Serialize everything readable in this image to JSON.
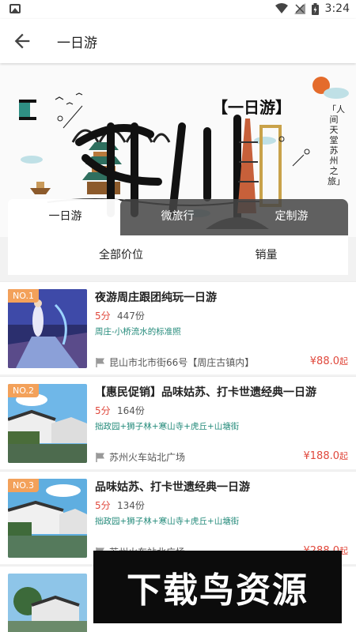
{
  "status_bar": {
    "time": "3:24",
    "icons": [
      "image-icon",
      "wifi-icon",
      "signal-icon",
      "battery-icon"
    ]
  },
  "app_bar": {
    "title": "一日游",
    "back_icon": "arrow-left-icon"
  },
  "banner": {
    "headline": "【一日游】",
    "big_text": "苏州",
    "vertical_text": "「人间天堂 苏州之旅」"
  },
  "tabs": [
    {
      "label": "一日游",
      "active": true
    },
    {
      "label": "微旅行",
      "active": false
    },
    {
      "label": "定制游",
      "active": false
    }
  ],
  "filters": {
    "price": "全部价位",
    "sales": "销量"
  },
  "items": [
    {
      "rank": "NO.1",
      "title": "夜游周庄跟团纯玩一日游",
      "score": "5分",
      "sales": "447份",
      "tags": "周庄-小桥流水的标准照",
      "location": "昆山市北市街66号【周庄古镇内】",
      "price": "¥88.0",
      "price_suffix": "起"
    },
    {
      "rank": "NO.2",
      "title": "【惠民促销】品味姑苏、打卡世遗经典一日游",
      "score": "5分",
      "sales": "164份",
      "tags": "拙政园+狮子林+寒山寺+虎丘+山塘街",
      "location": "苏州火车站北广场",
      "price": "¥188.0",
      "price_suffix": "起"
    },
    {
      "rank": "NO.3",
      "title": "品味姑苏、打卡世遗经典一日游",
      "score": "5分",
      "sales": "134份",
      "tags": "拙政园+狮子林+寒山寺+虎丘+山塘街",
      "location": "苏州火车站北广场",
      "price": "¥288.0",
      "price_suffix": "起"
    }
  ],
  "watermark": {
    "text": "下载鸟资源"
  },
  "colors": {
    "accent_red": "#e0483c",
    "tag_teal": "#238a7a",
    "badge_orange": "#f3a15a"
  }
}
